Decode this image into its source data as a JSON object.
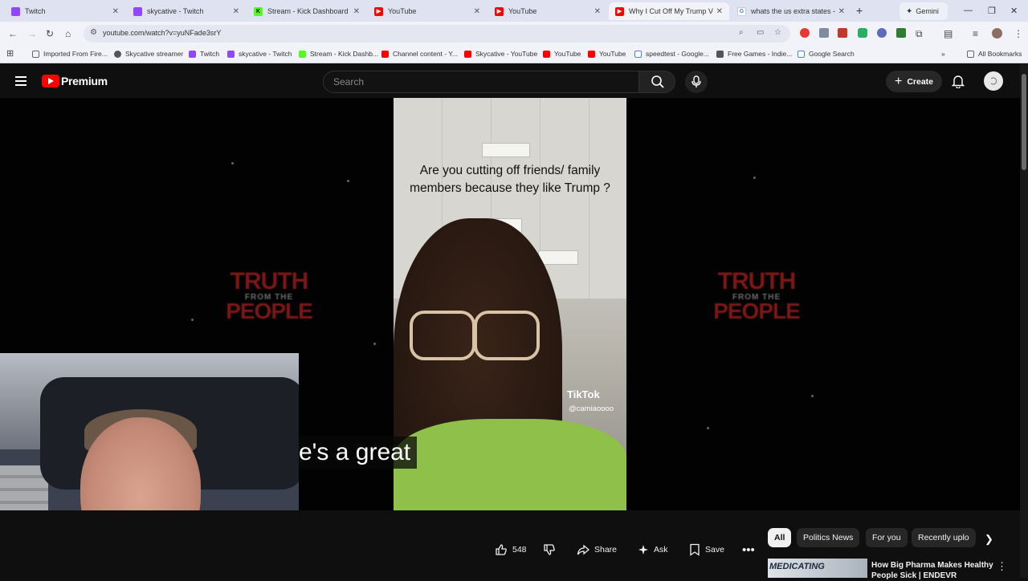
{
  "browser": {
    "tabs": [
      {
        "title": "Twitch",
        "icon": "twitch-icon",
        "active": false
      },
      {
        "title": "skycative - Twitch",
        "icon": "twitch-icon",
        "active": false
      },
      {
        "title": "Stream - Kick Dashboard",
        "icon": "kick-icon",
        "active": false
      },
      {
        "title": "YouTube",
        "icon": "youtube-icon",
        "active": false
      },
      {
        "title": "YouTube",
        "icon": "youtube-icon",
        "active": false
      },
      {
        "title": "Why I Cut Off My Trump Vot",
        "icon": "youtube-icon",
        "active": true
      },
      {
        "title": "whats the us extra states - G",
        "icon": "google-icon",
        "active": false
      }
    ],
    "gemini_label": "Gemini",
    "url": "youtube.com/watch?v=yuNFade3srY",
    "bookmarks": [
      {
        "label": "Imported From Fire...",
        "icon": "folder-icon"
      },
      {
        "label": "Skycative streamer",
        "icon": "link-icon"
      },
      {
        "label": "Twitch",
        "icon": "twitch-icon"
      },
      {
        "label": "skycative - Twitch",
        "icon": "twitch-icon"
      },
      {
        "label": "Stream - Kick Dashb...",
        "icon": "kick-icon"
      },
      {
        "label": "Channel content - Y...",
        "icon": "youtube-icon"
      },
      {
        "label": "Skycative - YouTube",
        "icon": "youtube-icon"
      },
      {
        "label": "YouTube",
        "icon": "youtube-icon"
      },
      {
        "label": "YouTube",
        "icon": "youtube-icon"
      },
      {
        "label": "speedtest - Google...",
        "icon": "google-icon"
      },
      {
        "label": "Free Games - Indie...",
        "icon": "page-icon"
      },
      {
        "label": "Google Search",
        "icon": "google-icon"
      }
    ],
    "all_bookmarks_label": "All Bookmarks"
  },
  "youtube": {
    "logo_text": "Premium",
    "search_placeholder": "Search",
    "create_label": "Create"
  },
  "video": {
    "tiktok_caption": "Are you cutting off friends/ family members because they like Trump ?",
    "tiktok_logo": "TikTok",
    "tiktok_handle": "@camiaoooo",
    "watermark_line1": "TRUTH",
    "watermark_line2": "FROM THE",
    "watermark_line3": "PEOPLE",
    "subtitle": "e's a great"
  },
  "actions": {
    "like_count": "548",
    "share_label": "Share",
    "ask_label": "Ask",
    "save_label": "Save"
  },
  "chips": [
    "All",
    "Politics News",
    "For you",
    "Recently uplo"
  ],
  "recommendation": {
    "thumb_text": "MEDICATING",
    "title": "How Big Pharma Makes Healthy People Sick | ENDEVR"
  },
  "colors": {
    "youtube_red": "#ff0000",
    "twitch_purple": "#9146ff",
    "kick_green": "#53fc18",
    "dark_bg": "#0f0f0f"
  }
}
